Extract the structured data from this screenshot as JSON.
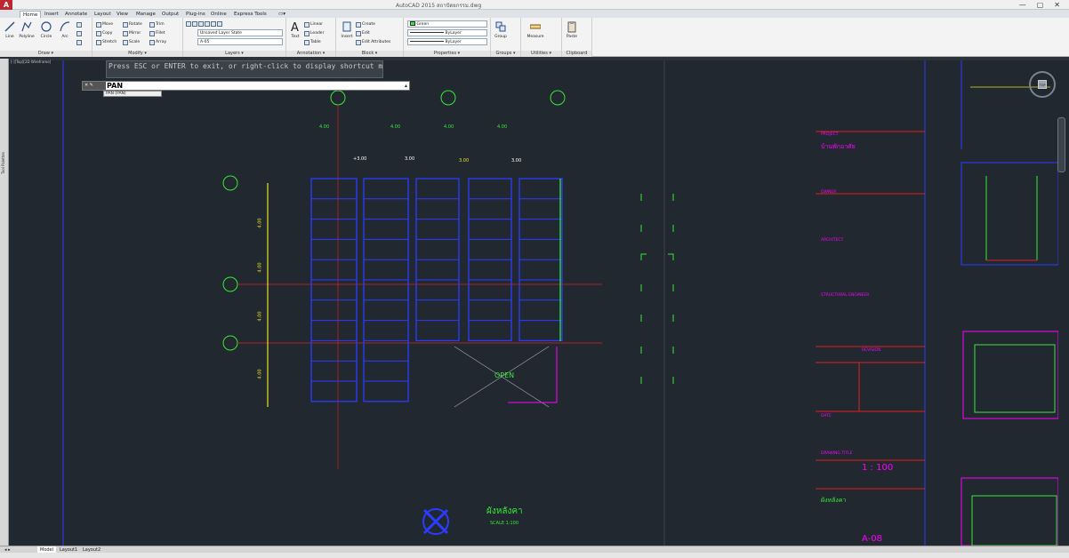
{
  "window": {
    "title": "AutoCAD 2015   สถาปัตยกรรม.dwg",
    "logo": "A",
    "controls": [
      "—",
      "▢",
      "✕"
    ]
  },
  "ribbon_tabs": [
    {
      "label": "Home",
      "active": true
    },
    {
      "label": "Insert"
    },
    {
      "label": "Annotate"
    },
    {
      "label": "Layout"
    },
    {
      "label": "View"
    },
    {
      "label": "Manage"
    },
    {
      "label": "Output"
    },
    {
      "label": "Plug-ins"
    },
    {
      "label": "Online"
    },
    {
      "label": "Express Tools"
    }
  ],
  "panels": {
    "draw": {
      "footer": "Draw ▾",
      "big": [
        "Line",
        "Polyline",
        "Circle",
        "Arc"
      ]
    },
    "modify": {
      "footer": "Modify ▾",
      "rows": [
        [
          "Move",
          "Rotate",
          "Trim"
        ],
        [
          "Copy",
          "Mirror",
          "Fillet"
        ],
        [
          "Stretch",
          "Scale",
          "Array"
        ]
      ]
    },
    "layers": {
      "footer": "Layers ▾",
      "state": "Unsaved Layer State",
      "current": "A-05"
    },
    "annotation": {
      "footer": "Annotation ▾",
      "big": "Text",
      "rows": [
        "Linear",
        "Leader",
        "Table"
      ]
    },
    "block": {
      "footer": "Block ▾",
      "big": "Insert",
      "rows": [
        "Create",
        "Edit",
        "Edit Attributes"
      ]
    },
    "properties": {
      "footer": "Properties ▾",
      "color": "Green",
      "linetype": "ByLayer",
      "lineweight": "ByLayer"
    },
    "groups": {
      "footer": "Groups ▾",
      "big": "Group"
    },
    "utilities": {
      "footer": "Utilities ▾",
      "big": "Measure"
    },
    "clipboard": {
      "footer": "Clipboard",
      "big": "Paste"
    }
  },
  "viewport_label": "[-][Top][2D Wireframe]",
  "palette_label": "Tool Palettes",
  "tooltip": "Press ESC or ENTER to exit, or right-click to display shortcut menu.",
  "command": {
    "close": "✕ ✎",
    "prompt": "PAN",
    "suggestion": "PAN (PAN)"
  },
  "viewcube": {
    "face": "TOP"
  },
  "drawing": {
    "title": "ผังหลังคา",
    "scale_label": "SCALE 1:100",
    "scale": "1 : 100",
    "sheet": "A-08",
    "open_label": "OPEN",
    "titleblock": {
      "project_label": "PROJECT",
      "project_name": "บ้านพักอาศัย",
      "owner": "OWNER",
      "architect": "ARCHITECT",
      "engineer": "STRUCTURAL ENGINEER",
      "revision": "REVISION",
      "date": "DATE",
      "drawing_title": "DRAWING TITLE",
      "sheet_name": "ผังหลังคา"
    },
    "dims_top": [
      "4.00",
      "4.00",
      "4.00",
      "4.00"
    ],
    "dims_left": [
      "4.00",
      "4.00",
      "4.00",
      "4.00"
    ],
    "labels": [
      "+3.00",
      "3.00",
      "3.00",
      "3.00"
    ]
  },
  "layout_tabs": [
    {
      "label": "Model",
      "active": true
    },
    {
      "label": "Layout1"
    },
    {
      "label": "Layout2"
    }
  ],
  "colors": {
    "canvas": "#212830",
    "blue": "#2b3cff",
    "green": "#38e838",
    "yellow": "#e8e020",
    "red": "#e02020",
    "magenta": "#ff00ff",
    "white": "#dddddd"
  }
}
